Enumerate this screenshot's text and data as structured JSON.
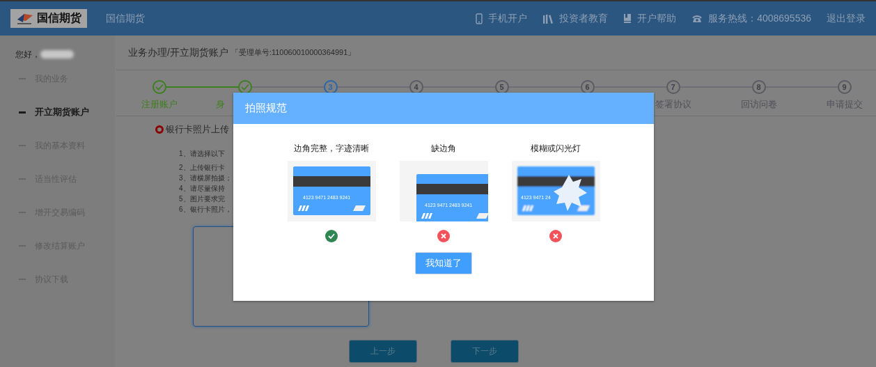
{
  "header": {
    "logo_text": "国信期货",
    "site_name": "国信期货",
    "links": [
      {
        "kind": "phone",
        "label": "手机开户"
      },
      {
        "kind": "books",
        "label": "投资者教育"
      },
      {
        "kind": "book",
        "label": "开户帮助"
      },
      {
        "kind": "tel",
        "label": "服务热线：4008695536"
      },
      {
        "kind": "plain",
        "label": "退出登录"
      }
    ]
  },
  "sidebar": {
    "greeting": "您好，",
    "items": [
      {
        "label": "我的业务",
        "selected": false
      },
      {
        "label": "开立期货账户",
        "selected": true
      },
      {
        "label": "我的基本资料",
        "selected": false
      },
      {
        "label": "适当性评估",
        "selected": false
      },
      {
        "label": "增开交易编码",
        "selected": false
      },
      {
        "label": "修改结算账户",
        "selected": false
      },
      {
        "label": "协议下载",
        "selected": false
      }
    ]
  },
  "breadcrumb": {
    "path": "业务办理/开立期货账户",
    "order_no": "「受理单号:110060010000364991」"
  },
  "steps": [
    {
      "label": "注册账户",
      "completed": true,
      "selected": false
    },
    {
      "label": "身",
      "label_cut_off": true,
      "completed": true,
      "selected": false
    },
    {
      "number": "3",
      "completed": false,
      "selected": true
    },
    {
      "number": "4",
      "completed": false,
      "selected": false
    },
    {
      "number": "5",
      "completed": false,
      "selected": false
    },
    {
      "number": "6",
      "completed": false,
      "selected": false
    },
    {
      "number": "7",
      "label": "签署协议",
      "completed": false,
      "selected": false
    },
    {
      "number": "8",
      "label": "回访问卷",
      "completed": false,
      "selected": false
    },
    {
      "number": "9",
      "label": "申请提交",
      "completed": false,
      "selected": false
    }
  ],
  "section": {
    "title": "银行卡照片上传",
    "instructions": [
      "1、请选择以下",
      "2、上传银行卡",
      "3、请横屏拍摄；",
      "4、请尽量保持",
      "5、图片要求完",
      "6、银行卡照片，"
    ]
  },
  "nav_buttons": [
    "上一步",
    "下一步"
  ],
  "dialog": {
    "title": "拍照规范",
    "examples": [
      {
        "caption": "边角完整，字迹清晰",
        "kind": "good",
        "card_number": "4123  9471  2483  9241",
        "passed": true
      },
      {
        "caption": "缺边角",
        "kind": "cropped",
        "card_number": "4123  9471  2483  9241",
        "passed": false
      },
      {
        "caption": "模糊或闪光灯",
        "kind": "blurry",
        "card_number": "4123  9471  24",
        "passed": false
      }
    ],
    "button": "我知道了"
  }
}
